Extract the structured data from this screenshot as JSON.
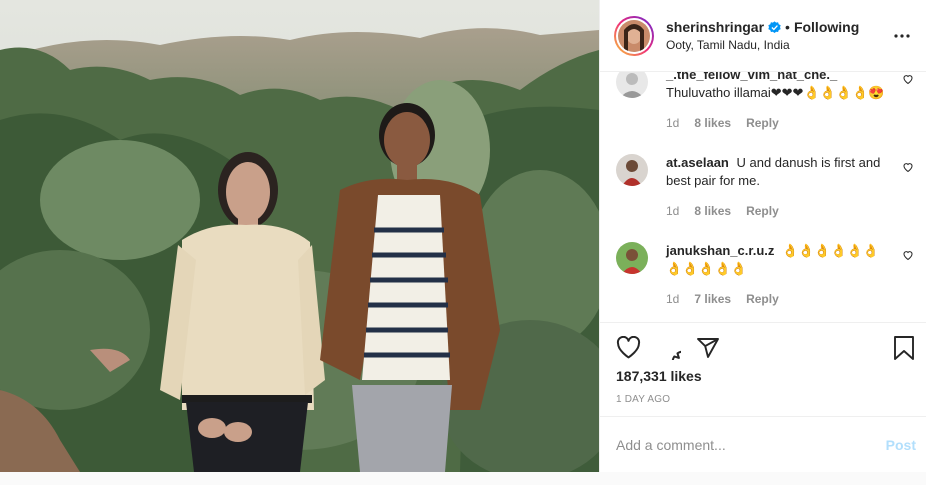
{
  "post": {
    "username": "sherinshringar",
    "dot": "•",
    "follow_status": "Following",
    "location": "Ooty, Tamil Nadu, India"
  },
  "comments": [
    {
      "username": "_.the_fellow_vim_nat_che._",
      "text": "Thuluvatho illamai❤❤❤👌👌👌👌😍",
      "age": "1d",
      "likes": "8 likes",
      "reply": "Reply"
    },
    {
      "username": "at.aselaan",
      "text": "U and danush is first and best pair for me.",
      "age": "1d",
      "likes": "8 likes",
      "reply": "Reply"
    },
    {
      "username": "janukshan_c.r.u.z",
      "text": "👌👌👌👌👌👌👌👌👌👌👌",
      "age": "1d",
      "likes": "7 likes",
      "reply": "Reply"
    }
  ],
  "stats": {
    "likes": "187,331 likes",
    "time_ago": "1 DAY AGO"
  },
  "composer": {
    "placeholder": "Add a comment...",
    "post_label": "Post"
  },
  "icons": {
    "verified": "verified-badge-icon",
    "more": "more-options-icon",
    "like": "heart-icon",
    "comment": "comment-icon",
    "share": "share-icon",
    "save": "bookmark-icon"
  },
  "colors": {
    "verified_blue": "#0095f6",
    "post_disabled": "#b2dffc",
    "muted_text": "#8e8e8e"
  }
}
